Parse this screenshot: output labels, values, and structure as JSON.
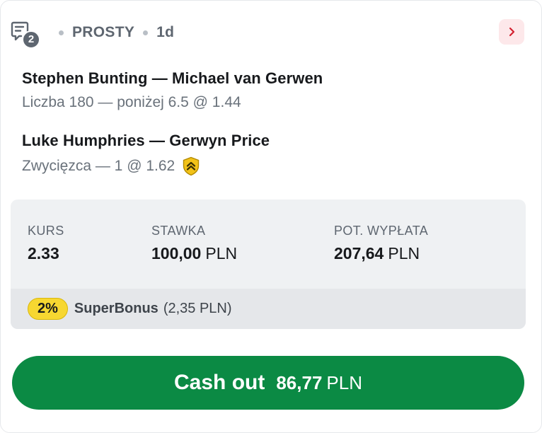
{
  "header": {
    "selections_count": "2",
    "bet_type": "PROSTY",
    "age": "1d"
  },
  "selections": [
    {
      "event": "Stephen Bunting — Michael van Gerwen",
      "pick": "Liczba 180 — poniżej 6.5 @ 1.44",
      "boosted": false
    },
    {
      "event": "Luke Humphries — Gerwyn Price",
      "pick": "Zwycięzca — 1 @ 1.62",
      "boosted": true
    }
  ],
  "summary": {
    "odds_label": "KURS",
    "odds_value": "2.33",
    "stake_label": "STAWKA",
    "stake_value": "100,00",
    "stake_currency": "PLN",
    "payout_label": "POT. WYPŁATA",
    "payout_value": "207,64",
    "payout_currency": "PLN"
  },
  "bonus": {
    "percent": "2%",
    "name": "SuperBonus",
    "amount": "(2,35 PLN)"
  },
  "cashout": {
    "label": "Cash out",
    "amount": "86,77",
    "currency": "PLN"
  },
  "colors": {
    "accent_green": "#0b8a44",
    "bonus_yellow": "#f7d731",
    "chevron_red": "#d3202f"
  },
  "icons": {
    "bet_slip": "bet-slip-icon",
    "chevron": "chevron-right-icon",
    "boost": "boost-shield-icon"
  }
}
